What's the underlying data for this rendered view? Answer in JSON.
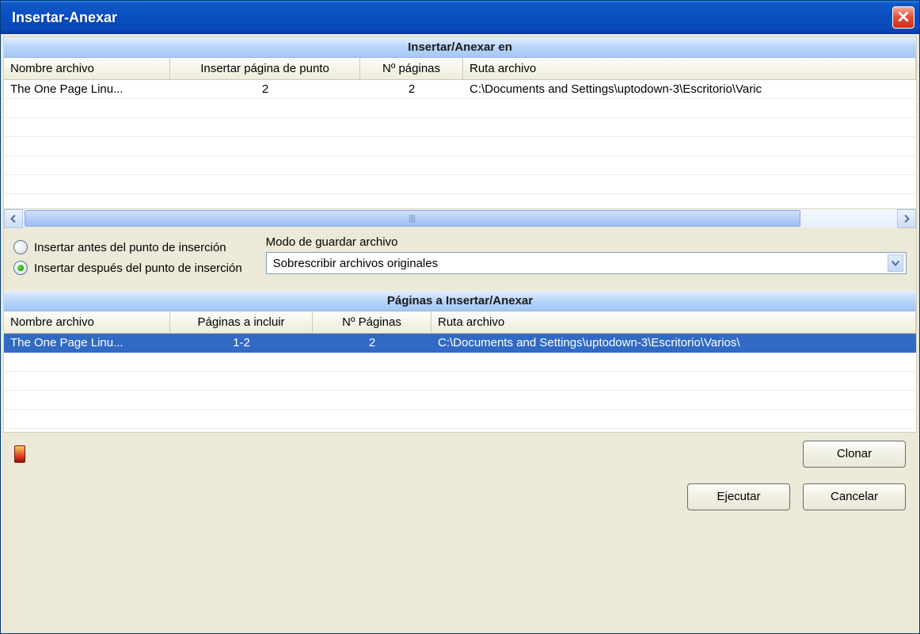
{
  "window": {
    "title": "Insertar-Anexar"
  },
  "top": {
    "header": "Insertar/Anexar en",
    "columns": [
      "Nombre archivo",
      "Insertar página de punto",
      "Nº páginas",
      "Ruta archivo"
    ],
    "rows": [
      {
        "name": "The One Page Linu...",
        "insert_point": "2",
        "pages": "2",
        "path": "C:\\Documents and Settings\\uptodown-3\\Escritorio\\Varic"
      }
    ]
  },
  "radios": {
    "before": "Insertar antes del punto de inserción",
    "after": "Insertar después del punto de inserción",
    "selected": "after"
  },
  "save_mode": {
    "label": "Modo de guardar archivo",
    "value": "Sobrescribir archivos originales"
  },
  "bottom": {
    "header": "Páginas a Insertar/Anexar",
    "columns": [
      "Nombre archivo",
      "Páginas a incluir",
      "Nº Páginas",
      "Ruta archivo"
    ],
    "rows": [
      {
        "name": "The One Page Linu...",
        "include": "1-2",
        "pages": "2",
        "path": "C:\\Documents and Settings\\uptodown-3\\Escritorio\\Varios\\"
      }
    ]
  },
  "buttons": {
    "clone": "Clonar",
    "execute": "Ejecutar",
    "cancel": "Cancelar"
  }
}
